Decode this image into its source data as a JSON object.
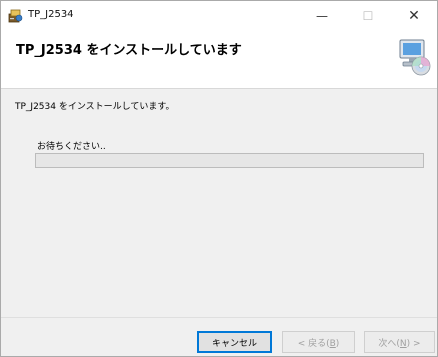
{
  "window": {
    "title": "TP_J2534",
    "minimize_glyph": "—",
    "maximize_glyph": "☐",
    "close_glyph": "✕"
  },
  "header": {
    "title": "TP_J2534 をインストールしています"
  },
  "body": {
    "status_text": "TP_J2534 をインストールしています。",
    "wait_text": "お待ちください..",
    "progress_percent": 0
  },
  "buttons": {
    "cancel_label": "キャンセル",
    "back_prefix": "< 戻る(",
    "back_key": "B",
    "back_suffix": ")",
    "next_prefix": "次へ(",
    "next_key": "N",
    "next_suffix": ") >"
  },
  "colors": {
    "accent": "#0078d7",
    "progress_fill": "#06b025"
  },
  "icons": {
    "app": "installer-icon",
    "header_art": "computer-disc-icon"
  }
}
